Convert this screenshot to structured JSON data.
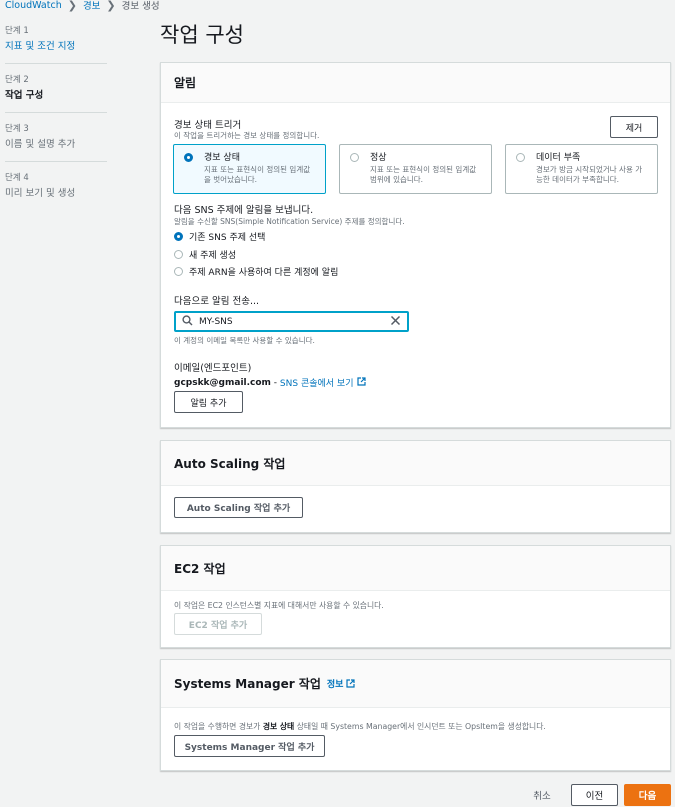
{
  "breadcrumb": [
    "CloudWatch",
    "경보",
    "경보 생성"
  ],
  "steps": [
    {
      "label": "단계 1",
      "title": "지표 및 조건 지정",
      "state": "link"
    },
    {
      "label": "단계 2",
      "title": "작업 구성",
      "state": "active"
    },
    {
      "label": "단계 3",
      "title": "이름 및 설명 추가",
      "state": "disabled"
    },
    {
      "label": "단계 4",
      "title": "미리 보기 및 생성",
      "state": "disabled"
    }
  ],
  "page_title": "작업 구성",
  "notification": {
    "header": "알림",
    "trigger_label": "경보 상태 트리거",
    "trigger_desc": "이 작업을 트리거하는 경보 상태를 정의합니다.",
    "remove_label": "제거",
    "tiles": [
      {
        "title": "경보 상태",
        "desc": "지표 또는 표현식이 정의된 임계값을 벗어났습니다.",
        "selected": true
      },
      {
        "title": "정상",
        "desc": "지표 또는 표현식이 정의된 임계값 범위에 있습니다.",
        "selected": false
      },
      {
        "title": "데이터 부족",
        "desc": "경보가 방금 시작되었거나 사용 가능한 데이터가 부족합니다.",
        "selected": false
      }
    ],
    "sns_label": "다음 SNS 주제에 알림을 보냅니다.",
    "sns_desc": "알림을 수신할 SNS(Simple Notification Service) 주제를 정의합니다.",
    "sns_options": [
      {
        "label": "기존 SNS 주제 선택",
        "selected": true
      },
      {
        "label": "새 주제 생성",
        "selected": false
      },
      {
        "label": "주제 ARN을 사용하여 다른 계정에 알림",
        "selected": false
      }
    ],
    "send_to_label": "다음으로 알림 전송...",
    "search_value": "MY-SNS",
    "search_hint": "이 계정의 이메일 목록만 사용할 수 있습니다.",
    "email_label": "이메일(엔드포인트)",
    "email_value": "gcpskk@gmail.com",
    "email_sep": " - ",
    "sns_console_link": "SNS 콘솔에서 보기",
    "add_notification": "알림 추가"
  },
  "autoscaling": {
    "header": "Auto Scaling 작업",
    "add_button": "Auto Scaling 작업 추가"
  },
  "ec2": {
    "header": "EC2 작업",
    "desc": "이 작업은 EC2 인스턴스별 지표에 대해서만 사용할 수 있습니다.",
    "add_button": "EC2 작업 추가"
  },
  "ssm": {
    "header": "Systems Manager 작업",
    "info_link": "정보",
    "desc_pre": "이 작업을 수행하면 경보가 ",
    "desc_bold": "경보 상태",
    "desc_post": " 상태일 때 Systems Manager에서 인시던트 또는 OpsItem을 생성합니다.",
    "add_button": "Systems Manager 작업 추가"
  },
  "footer": {
    "cancel": "취소",
    "previous": "이전",
    "next": "다음"
  },
  "colors": {
    "primary": "#ec7211",
    "link": "#0073bb",
    "focus": "#00a1c9"
  }
}
